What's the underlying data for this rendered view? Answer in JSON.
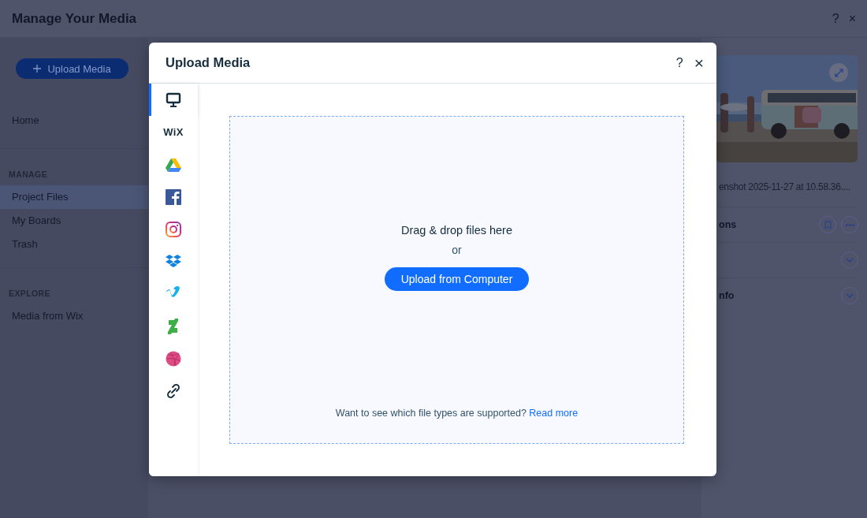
{
  "app": {
    "title": "Manage Your Media",
    "help": "?",
    "close": "×"
  },
  "sidebar": {
    "upload_button": "Upload Media",
    "sections": [
      {
        "items": [
          {
            "label": "Home",
            "selected": false
          }
        ]
      },
      {
        "heading": "MANAGE",
        "items": [
          {
            "label": "Project Files",
            "selected": true
          },
          {
            "label": "My Boards",
            "selected": false
          },
          {
            "label": "Trash",
            "selected": false
          }
        ]
      },
      {
        "heading": "EXPLORE",
        "items": [
          {
            "label": "Media from Wix",
            "selected": false
          }
        ]
      }
    ]
  },
  "details": {
    "file_name": "enshot 2025-11-27 at 10.58.36....",
    "sections": [
      {
        "kind": "actions",
        "title": "ons"
      },
      {
        "kind": "collapsible",
        "expanded": false
      },
      {
        "kind": "collapsible",
        "title": "nfo",
        "expanded": false
      }
    ]
  },
  "dialog": {
    "title": "Upload Media",
    "help": "?",
    "close": "×",
    "sources": [
      {
        "kind": "computer",
        "selected": true
      },
      {
        "kind": "wix",
        "label": "WiX",
        "selected": false
      },
      {
        "kind": "drive",
        "selected": false
      },
      {
        "kind": "facebook",
        "selected": false
      },
      {
        "kind": "instagram",
        "selected": false
      },
      {
        "kind": "dropbox",
        "selected": false
      },
      {
        "kind": "vimeo",
        "selected": false
      },
      {
        "kind": "deviantart",
        "selected": false
      },
      {
        "kind": "dribbble",
        "selected": false
      },
      {
        "kind": "link",
        "selected": false
      }
    ],
    "dropzone": {
      "heading": "Drag & drop files here",
      "separator": "or",
      "button": "Upload from Computer",
      "note": "Want to see which file types are supported?",
      "link": "Read more"
    }
  }
}
